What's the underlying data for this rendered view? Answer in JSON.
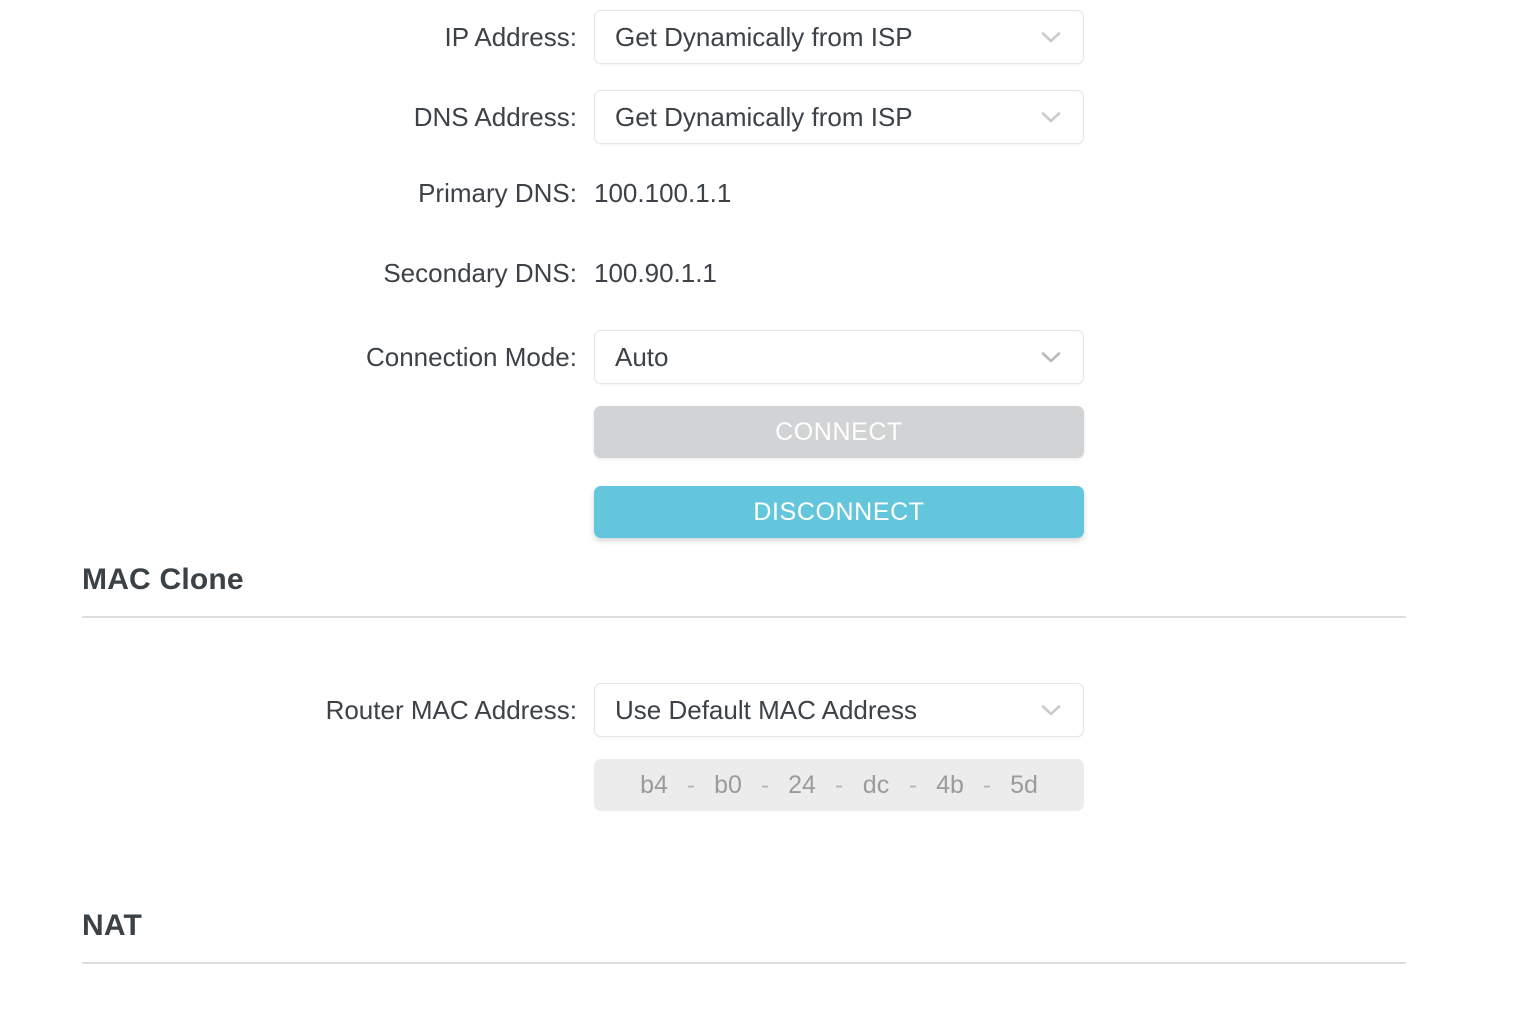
{
  "internet_section": {
    "rows": [
      {
        "id": "ip-address",
        "label": "IP Address:",
        "type": "select",
        "value": "Get Dynamically from ISP",
        "icon": "chevron-down-icon"
      },
      {
        "id": "dns-address",
        "label": "DNS Address:",
        "type": "select",
        "value": "Get Dynamically from ISP",
        "icon": "chevron-down-icon"
      },
      {
        "id": "primary-dns",
        "label": "Primary DNS:",
        "type": "text",
        "value": "100.100.1.1"
      },
      {
        "id": "secondary-dns",
        "label": "Secondary DNS:",
        "type": "text",
        "value": "100.90.1.1"
      },
      {
        "id": "connection-mode",
        "label": "Connection Mode:",
        "type": "select",
        "value": "Auto",
        "icon": "chevron-down-icon"
      }
    ],
    "buttons": {
      "connect": "CONNECT",
      "disconnect": "DISCONNECT"
    }
  },
  "mac_clone_section": {
    "title": "MAC Clone",
    "row": {
      "label": "Router MAC Address:",
      "value": "Use Default MAC Address",
      "icon": "chevron-down-icon"
    },
    "mac_address": {
      "octets": [
        "b4",
        "b0",
        "24",
        "dc",
        "4b",
        "5d"
      ],
      "separator": "-"
    }
  },
  "nat_section": {
    "title": "NAT"
  },
  "colors": {
    "accent": "#63c6dc",
    "disabled_button": "#d2d3d4",
    "text": "#3c4247",
    "border": "#e3e5e7",
    "rule": "#dcdde0",
    "disabled_field_bg": "#ececec",
    "disabled_field_text": "#9b9b9b"
  }
}
